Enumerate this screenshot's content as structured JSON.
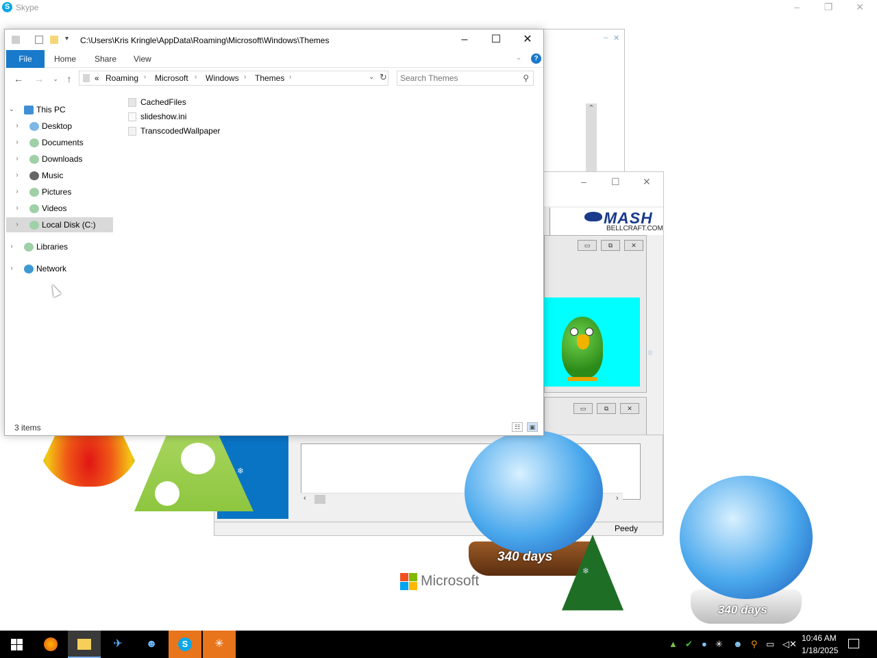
{
  "skype": {
    "title": "Skype",
    "icon": "skype-icon"
  },
  "explorer": {
    "title_path": "C:\\Users\\Kris Kringle\\AppData\\Roaming\\Microsoft\\Windows\\Themes",
    "ribbon_tabs": [
      "File",
      "Home",
      "Share",
      "View"
    ],
    "breadcrumb": [
      "«",
      "Roaming",
      "Microsoft",
      "Windows",
      "Themes"
    ],
    "search_placeholder": "Search Themes",
    "nav_tree": [
      {
        "label": "This PC",
        "level": 0,
        "expanded": true
      },
      {
        "label": "Desktop",
        "level": 1
      },
      {
        "label": "Documents",
        "level": 1
      },
      {
        "label": "Downloads",
        "level": 1
      },
      {
        "label": "Music",
        "level": 1
      },
      {
        "label": "Pictures",
        "level": 1
      },
      {
        "label": "Videos",
        "level": 1
      },
      {
        "label": "Local Disk (C:)",
        "level": 1,
        "selected": true
      },
      {
        "label": "Libraries",
        "level": 0
      },
      {
        "label": "Network",
        "level": 0
      }
    ],
    "files": [
      "CachedFiles",
      "slideshow.ini",
      "TranscodedWallpaper"
    ],
    "status_count": "3 items"
  },
  "mash": {
    "brand": "MASH",
    "site": "BELLCRAFT.COM"
  },
  "lower_window": {
    "status_label": "Peedy"
  },
  "decor": {
    "days_label_1": "340 days",
    "days_label_2": "340 days",
    "microsoft_text": "Microsoft"
  },
  "taskbar": {
    "apps": [
      "firefox-icon",
      "file-explorer-icon",
      "airplane-app-icon",
      "agent-app-icon",
      "skype-icon",
      "snowflake-app-icon"
    ],
    "time": "10:46 AM",
    "date": "1/18/2025"
  }
}
